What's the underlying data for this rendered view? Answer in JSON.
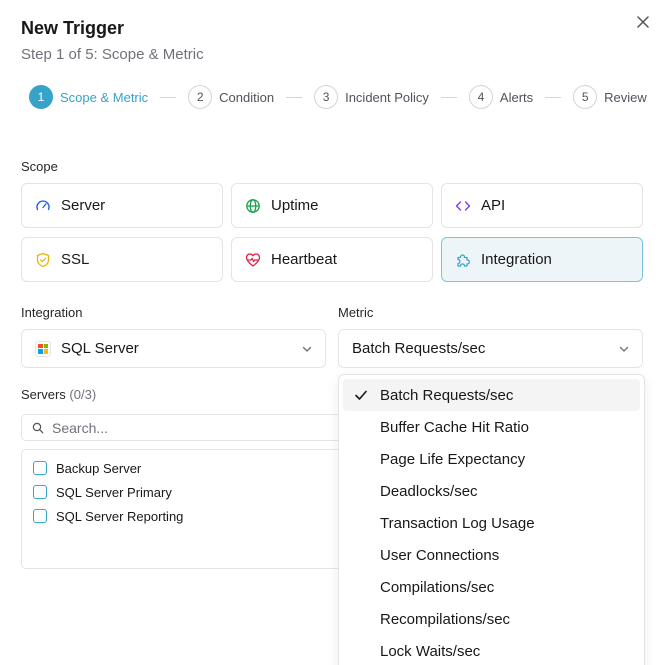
{
  "dialog": {
    "title": "New Trigger",
    "subtitle": "Step 1 of 5: Scope & Metric"
  },
  "steps": [
    {
      "num": "1",
      "label": "Scope & Metric",
      "active": true
    },
    {
      "num": "2",
      "label": "Condition",
      "active": false
    },
    {
      "num": "3",
      "label": "Incident Policy",
      "active": false
    },
    {
      "num": "4",
      "label": "Alerts",
      "active": false
    },
    {
      "num": "5",
      "label": "Review",
      "active": false
    }
  ],
  "scope": {
    "label": "Scope",
    "options": [
      {
        "label": "Server",
        "icon": "gauge-icon"
      },
      {
        "label": "Uptime",
        "icon": "globe-icon"
      },
      {
        "label": "API",
        "icon": "code-icon"
      },
      {
        "label": "SSL",
        "icon": "shield-icon"
      },
      {
        "label": "Heartbeat",
        "icon": "heart-pulse-icon"
      },
      {
        "label": "Integration",
        "icon": "puzzle-icon",
        "selected": true
      }
    ]
  },
  "integration": {
    "label": "Integration",
    "value": "SQL Server"
  },
  "metric": {
    "label": "Metric",
    "value": "Batch Requests/sec",
    "options": [
      "Batch Requests/sec",
      "Buffer Cache Hit Ratio",
      "Page Life Expectancy",
      "Deadlocks/sec",
      "Transaction Log Usage",
      "User Connections",
      "Compilations/sec",
      "Recompilations/sec",
      "Lock Waits/sec"
    ]
  },
  "servers": {
    "label": "Servers",
    "count": "(0/3)",
    "search_placeholder": "Search...",
    "items": [
      "Backup Server",
      "SQL Server Primary",
      "SQL Server Reporting"
    ]
  },
  "colors": {
    "accent": "#38a3c8",
    "border": "#e4e4e7",
    "selected_bg": "#eef5f9"
  }
}
